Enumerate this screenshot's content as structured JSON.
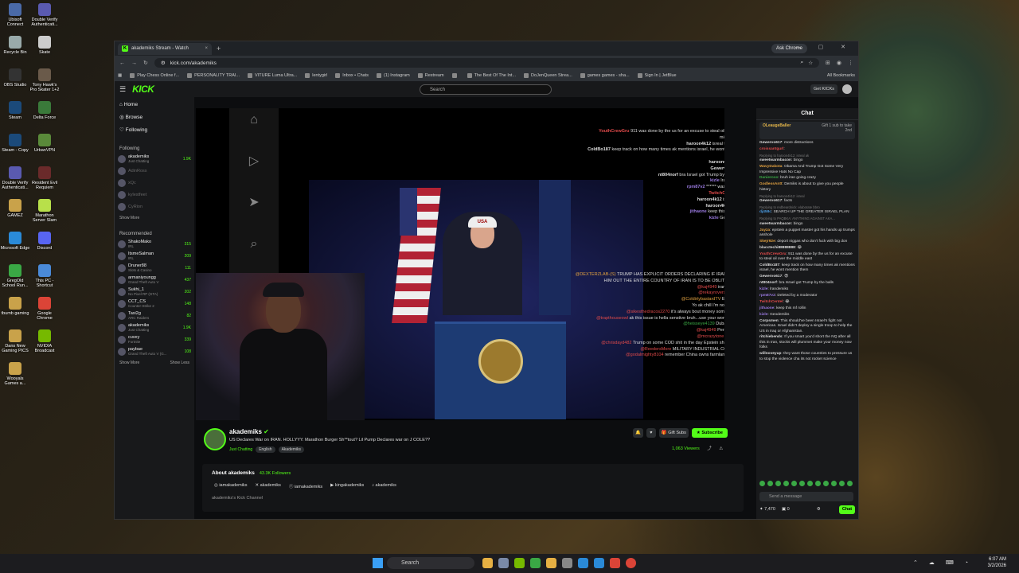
{
  "desktop": {
    "icons": [
      {
        "label": "Ubisoft Connect",
        "color": "#4a6aa8"
      },
      {
        "label": "Double Verify Authenticati...",
        "color": "#5a5ab0"
      },
      {
        "label": "Recycle Bin",
        "color": "#9aa"
      },
      {
        "label": "Skate",
        "color": "#ccc"
      },
      {
        "label": "OBS Studio",
        "color": "#333"
      },
      {
        "label": "Tony Hawk's Pro Skater 1+2",
        "color": "#6a5a4a"
      },
      {
        "label": "Steam",
        "color": "#1b4a7a"
      },
      {
        "label": "Delta Force",
        "color": "#3a7a3a"
      },
      {
        "label": "Steam - Copy",
        "color": "#1b4a7a"
      },
      {
        "label": "UrbanVPN",
        "color": "#5a8a3a"
      },
      {
        "label": "Double Verify Authenticati...",
        "color": "#5a5ab0"
      },
      {
        "label": "Resident Evil Requiem",
        "color": "#6a2a2a"
      },
      {
        "label": "GAMEZ",
        "color": "#c9a24a"
      },
      {
        "label": "Marathon Server Slam",
        "color": "#b8e04a"
      },
      {
        "label": "Microsoft Edge",
        "color": "#2a8ad8"
      },
      {
        "label": "Discord",
        "color": "#5865f2"
      },
      {
        "label": "GregOld School Run...",
        "color": "#3aa845"
      },
      {
        "label": "This PC - Shortcut",
        "color": "#4a8ad8"
      },
      {
        "label": "tbumb gaming",
        "color": "#c9a24a"
      },
      {
        "label": "Google Chrome",
        "color": "#db4437"
      },
      {
        "label": "Dans New Gaming PICS",
        "color": "#c9a24a"
      },
      {
        "label": "NVIDIA Broadcast",
        "color": "#76b900"
      },
      {
        "label": "Wooyals Games a...",
        "color": "#c9a24a"
      }
    ]
  },
  "browser": {
    "tab_title": "akademiks Stream - Watch",
    "tab_close": "×",
    "new_tab": "+",
    "ask_chrome": "Ask Chrome",
    "window_controls": "— ▢ ✕",
    "url": "kick.com/akademiks",
    "bookmarks": [
      "Play Chess Online f...",
      "PERSONALITY TRAI...",
      "VITURE Luma Ultra...",
      "lentygirl",
      "Inbox • Chats",
      "(1) Instagram",
      "Restream",
      "",
      "The Best Of The Int...",
      "DoJenQueen Strea...",
      "games games - sha...",
      "Sign In | JetBlue"
    ],
    "all_bookmarks": "All Bookmarks"
  },
  "kick": {
    "logo": "KICK",
    "search_placeholder": "Search",
    "get_kicks": "Get KICKs",
    "nav": [
      "Home",
      "Browse",
      "Following"
    ],
    "following_header": "Following",
    "following": [
      {
        "name": "akademiks",
        "sub": "Just Chatting",
        "count": "1.9K",
        "live": true
      },
      {
        "name": "AdinRoss",
        "sub": "",
        "count": "",
        "live": false
      },
      {
        "name": "xQc",
        "sub": "",
        "count": "",
        "live": false
      },
      {
        "name": "kylestfeet",
        "sub": "",
        "count": "",
        "live": false
      },
      {
        "name": "CyRion",
        "sub": "",
        "count": "",
        "live": false
      }
    ],
    "show_more": "Show More",
    "recommended_header": "Recommended",
    "recommended": [
      {
        "name": "ShakoMako",
        "sub": "IRL",
        "count": "315"
      },
      {
        "name": "ItsmeSalman",
        "sub": "IRL",
        "count": "209"
      },
      {
        "name": "Druner88",
        "sub": "Slots & Casino",
        "count": "111"
      },
      {
        "name": "armaniyoungg",
        "sub": "Grand Theft Auto V",
        "count": "437"
      },
      {
        "name": "Sukhi_1",
        "sub": "No Pixel RP (GTA)",
        "count": "202"
      },
      {
        "name": "CCT_CS",
        "sub": "Counter-Strike 2",
        "count": "148"
      },
      {
        "name": "Taxi2g",
        "sub": "ARC Raiders",
        "count": "82"
      },
      {
        "name": "akademiks",
        "sub": "Just Chatting",
        "count": "1.9K"
      },
      {
        "name": "cuvey",
        "sub": "Fortnite",
        "count": "339"
      },
      {
        "name": "paybae",
        "sub": "Grand Theft Auto V (G...",
        "count": "108"
      }
    ],
    "show_less": "Show Less"
  },
  "video_chat": [
    {
      "user": "YouthCrewGru",
      "color": "#e04a4a",
      "text": "911 was done by the us for an excuse to steal oil over the middle east"
    },
    {
      "user": "haroon4k12",
      "color": "#ddd",
      "text": "isreal tell trump"
    },
    {
      "user": "ColdBo187",
      "color": "#ddd",
      "text": "keep track on how many times ak mentions israel, he wont mention them"
    },
    {
      "user": "haroon4k12",
      "color": "#ddd",
      "text": "fam"
    },
    {
      "user": "Gewervo617",
      "color": "#ddd",
      "text": "😨"
    },
    {
      "user": "nt804norf",
      "color": "#ddd",
      "text": "bra Israel got Trump by the balls"
    },
    {
      "user": "kizle",
      "color": "#9a7ae0",
      "text": "lrandemiks"
    },
    {
      "user": "rpm87v2",
      "color": "#9a7ae0",
      "text": "****** was right AK"
    },
    {
      "user": "TwitchCentel",
      "color": "#e04a4a",
      "text": "😂"
    },
    {
      "user": "haroon4k12",
      "color": "#ddd",
      "text": "isreal fam"
    },
    {
      "user": "haroon4k12",
      "color": "#ddd",
      "text": "isreal"
    },
    {
      "user": "jithaone",
      "color": "#9a7ae0",
      "text": "keep this mf rollin"
    },
    {
      "user": "kizle",
      "color": "#9a7ae0",
      "text": "Geodemiks"
    }
  ],
  "video_chat2": [
    {
      "user": "@DEXTERZLAB-(S)",
      "color": "#e0a040",
      "text": "TRUMP HAS EXPLICIT ORDERS DECLARING IF IRAN TAKES HIM OUT THE ENTIRE COUNTRY OF IRAN IS TO BE OBLITERATED"
    },
    {
      "user": "@kaj4949",
      "color": "#e04a4a",
      "text": "iran baddies"
    },
    {
      "user": "@rekayrovers",
      "color": "#e04a4a",
      "text": "ITS OIL"
    },
    {
      "user": "@ColdirtybastardTV",
      "color": "#e0a040",
      "text": "El Trumpo"
    },
    {
      "user": "",
      "color": "#ddd",
      "text": "Yo ak chill I'm not like that"
    },
    {
      "user": "@sikesthedracos2270",
      "color": "#e04a4a",
      "text": "it's always bout money someway tho"
    },
    {
      "user": "@trapthouseowl",
      "color": "#e04a4a",
      "text": "ak this issue is hella senstive bruh...use your words wisely"
    },
    {
      "user": "@heisseye4139",
      "color": "#3aa845",
      "text": "Dubai as well"
    },
    {
      "user": "@kaj4949",
      "color": "#e04a4a",
      "text": "Persian rugs"
    },
    {
      "user": "@mcrazytone",
      "color": "#e04a4a",
      "text": "america!"
    },
    {
      "user": "@chrisdayd482",
      "color": "#e04a4a",
      "text": "Trump on some COD shit in the day Epstein shit at night"
    },
    {
      "user": "@ReedersMore",
      "color": "#e04a4a",
      "text": "MILITARY INDUSTRIAL COMPLEX"
    },
    {
      "user": "@godalmighty8104",
      "color": "#e04a4a",
      "text": "remember China owns farmland in USA"
    }
  ],
  "channel": {
    "name": "akademiks",
    "title": "US Declares War on IRAN. HOLLYYY. Marathon Burger Sh**tout? Lil Pump Declares war on J COLE??",
    "category": "Just Chatting",
    "tags": [
      "English",
      "Akademiks"
    ],
    "gift_subs": "Gift Subs",
    "subscribe": "Subscribe",
    "viewers": "1,063 Viewers",
    "about_title": "About akademiks",
    "followers": "43.3K Followers",
    "socials": [
      "iamakademiks",
      "akademiks",
      "iamakademiks",
      "kingakademiks",
      "akademiks"
    ],
    "description": "akademiks's Kick Channel"
  },
  "chat": {
    "title": "Chat",
    "gift_user": "OLeaugeBaller",
    "gift_text": "Gift 1 sub to take 2nd",
    "messages": [
      {
        "user": "Gewervo617",
        "color": "#ddd",
        "text": "more distractions",
        "reply": ""
      },
      {
        "user": "croissantgurl",
        "color": "#e04a4a",
        "text": "",
        "reply": ""
      },
      {
        "user": "sweetwarmbacon",
        "color": "#ddd",
        "text": "bingo",
        "reply": "Replying to haroon4k12: isreal ak"
      },
      {
        "user": "WavyDakota",
        "color": "#e0a040",
        "text": "Obama And Trump Got Some Very Impressive Hats No Cap",
        "reply": ""
      },
      {
        "user": "Danieroso",
        "color": "#3aa845",
        "text": "bruh iran going crazy",
        "reply": ""
      },
      {
        "user": "GodlessAntt",
        "color": "#e0a040",
        "text": "Demiks is about to give you people history",
        "reply": ""
      },
      {
        "user": "Gewervo617",
        "color": "#ddd",
        "text": "facts",
        "reply": "Replying to haroon4k12: isreal"
      },
      {
        "user": "dj458c",
        "color": "#4a9ae0",
        "text": "SEARCH UP THE GREATER ISRAEL PLAN",
        "reply": "Replying to redbeardnick: elaborate bbro"
      },
      {
        "user": "sweetwarmbacon",
        "color": "#ddd",
        "text": "bingo",
        "reply": "Replying to PAQBKA: ANYTHING AGAINST AKA..."
      },
      {
        "user": "Jayza",
        "color": "#e0a040",
        "text": "epstein a puppet master got his hands up trumps asshole",
        "reply": ""
      },
      {
        "user": "Skejr92e",
        "color": "#e0a040",
        "text": "deport niggas who don't fuck with big don",
        "reply": ""
      },
      {
        "user": "blacctechi88888888",
        "color": "#ddd",
        "text": "😂",
        "reply": ""
      },
      {
        "user": "YouthCrewGru",
        "color": "#e04a4a",
        "text": "911 was done by the us for an excuse to steal oil over the middle east",
        "reply": ""
      },
      {
        "user": "ColdBo187",
        "color": "#ddd",
        "text": "keep track on how many times ak mentions israel, he wont mention them",
        "reply": ""
      },
      {
        "user": "Gewervo617",
        "color": "#ddd",
        "text": "😨",
        "reply": ""
      },
      {
        "user": "nt804norf",
        "color": "#ddd",
        "text": "bra Israel got Trump by the balls",
        "reply": ""
      },
      {
        "user": "kizle",
        "color": "#9a7ae0",
        "text": "lrandemiks",
        "reply": ""
      },
      {
        "user": "rpm87v2",
        "color": "#9a7ae0",
        "text": "Deleted by a moderator",
        "reply": ""
      },
      {
        "user": "TwitchCentel",
        "color": "#e04a4a",
        "text": "😂",
        "reply": ""
      },
      {
        "user": "jithaone",
        "color": "#9a7ae0",
        "text": "keep this mf rollin",
        "reply": ""
      },
      {
        "user": "kizle",
        "color": "#9a7ae0",
        "text": "Geodemiks",
        "reply": ""
      },
      {
        "user": "Corpsmen",
        "color": "#ddd",
        "text": "This should've been Israel's fight not Americas. Israel didn't deploy a single troop to help the US in Iraq or Afghanistan.",
        "reply": ""
      },
      {
        "user": "ritchiebends",
        "color": "#ddd",
        "text": "If you smart you'd short the NQ after all this in Iran, stocks will plummet make your money now folks",
        "reply": ""
      },
      {
        "user": "willnoveyup",
        "color": "#ddd",
        "text": "they want those countries to pressure us to stop the violence cha its not rocket science",
        "reply": ""
      }
    ],
    "input_placeholder": "Send a message",
    "points": "7,470",
    "badge_count": "0",
    "send": "Chat"
  },
  "taskbar": {
    "search": "Search",
    "time": "6:07 AM",
    "date": "3/2/2026"
  }
}
